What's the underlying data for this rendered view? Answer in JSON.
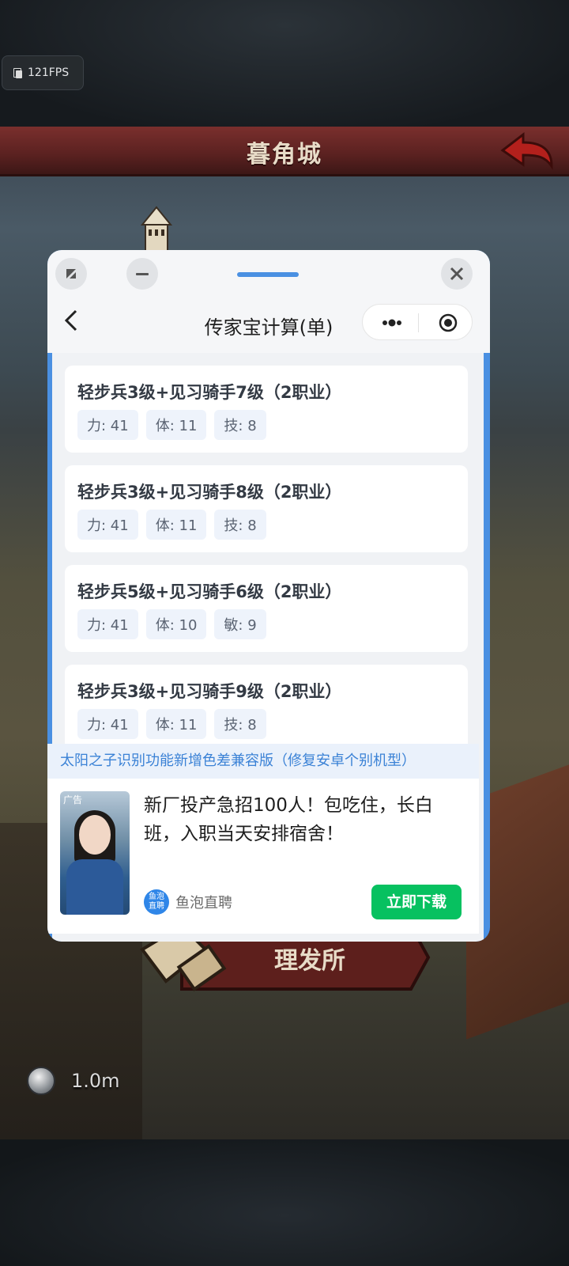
{
  "status": {
    "fps": "121FPS"
  },
  "game": {
    "location_title": "暮角城",
    "banner_label": "理发所",
    "currency": "1.0m"
  },
  "mini_program": {
    "title": "传家宝计算(单)",
    "results": [
      {
        "title": "轻步兵3级+见习骑手7级（2职业）",
        "stats": [
          "力: 41",
          "体: 11",
          "技: 8"
        ]
      },
      {
        "title": "轻步兵3级+见习骑手8级（2职业）",
        "stats": [
          "力: 41",
          "体: 11",
          "技: 8"
        ]
      },
      {
        "title": "轻步兵5级+见习骑手6级（2职业）",
        "stats": [
          "力: 41",
          "体: 10",
          "敏: 9"
        ]
      },
      {
        "title": "轻步兵3级+见习骑手9级（2职业）",
        "stats": [
          "力: 41",
          "体: 11",
          "技: 8"
        ]
      }
    ],
    "notice": "太阳之子识别功能新增色差兼容版（修复安卓个别机型）",
    "ad": {
      "tag": "广告",
      "text": "新厂投产急招100人！包吃住，长白班，入职当天安排宿舍！",
      "brand_logo_line1": "鱼泡",
      "brand_logo_line2": "直聘",
      "brand_name": "鱼泡直聘",
      "cta": "立即下载"
    }
  },
  "colors": {
    "accent_blue": "#4a90e2",
    "cta_green": "#07c160",
    "title_bar_red": "#7a2f2d"
  }
}
